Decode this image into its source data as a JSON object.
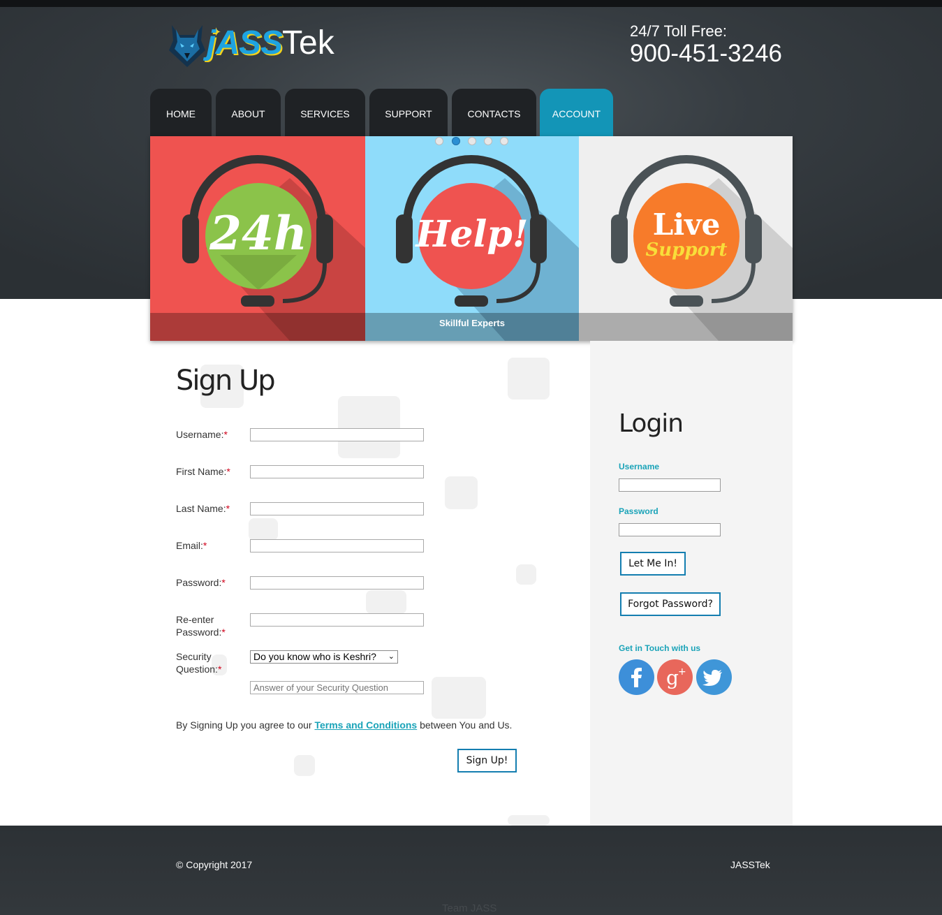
{
  "header": {
    "logo_jass": "jASS",
    "logo_tek": "Tek",
    "toll_label": "24/7 Toll Free:",
    "toll_number": "900-451-3246"
  },
  "nav": {
    "items": [
      {
        "label": "HOME",
        "active": false
      },
      {
        "label": "ABOUT",
        "active": false
      },
      {
        "label": "SERVICES",
        "active": false
      },
      {
        "label": "SUPPORT",
        "active": false
      },
      {
        "label": "CONTACTS",
        "active": false
      },
      {
        "label": "ACCOUNT",
        "active": true
      }
    ]
  },
  "slider": {
    "panels": [
      {
        "text": "24h",
        "bg": "#ef5350",
        "circle": "#8bc34a"
      },
      {
        "text": "Help!",
        "bg": "#8fdcfa",
        "circle": "#ef5350"
      },
      {
        "text_line1": "Live",
        "text_line2": "Support",
        "bg": "#efefef",
        "circle": "#f77b2a"
      }
    ],
    "caption": "Skillful Experts",
    "dots": 5,
    "active_dot": 2
  },
  "signup": {
    "title": "Sign Up",
    "fields": [
      {
        "label": "Username:",
        "required_mark": "*"
      },
      {
        "label": "First Name:",
        "required_mark": "*"
      },
      {
        "label": "Last Name:",
        "required_mark": "*"
      },
      {
        "label": "Email:",
        "required_mark": "*"
      },
      {
        "label": "Password:",
        "required_mark": "*"
      },
      {
        "label_line1": "Re-enter",
        "label_line2": "Password:",
        "required_mark": "*"
      },
      {
        "label_line1": "Security",
        "label_line2": "Question:",
        "required_mark": "*"
      }
    ],
    "security_question_selected": "Do you know who is Keshri?",
    "answer_placeholder": "Answer of your Security Question",
    "terms_prefix": "By Signing Up you agree to our ",
    "terms_link": "Terms and Conditions",
    "terms_suffix": " between You and Us.",
    "submit_label": "Sign Up!"
  },
  "login": {
    "title": "Login",
    "username_label": "Username",
    "password_label": "Password",
    "submit_label": "Let Me In!",
    "forgot_label": "Forgot Password?",
    "social_heading": "Get in Touch with us",
    "social": [
      {
        "icon": "facebook-icon",
        "glyph": "f",
        "color": "#3d8fd9"
      },
      {
        "icon": "google-plus-icon",
        "glyph": "g+",
        "color": "#e8675b"
      },
      {
        "icon": "twitter-icon",
        "glyph": "t",
        "color": "#3f96d8"
      }
    ]
  },
  "footer": {
    "copyright": "© Copyright 2017",
    "brand": "JASSTek",
    "team": "Team JASS"
  }
}
